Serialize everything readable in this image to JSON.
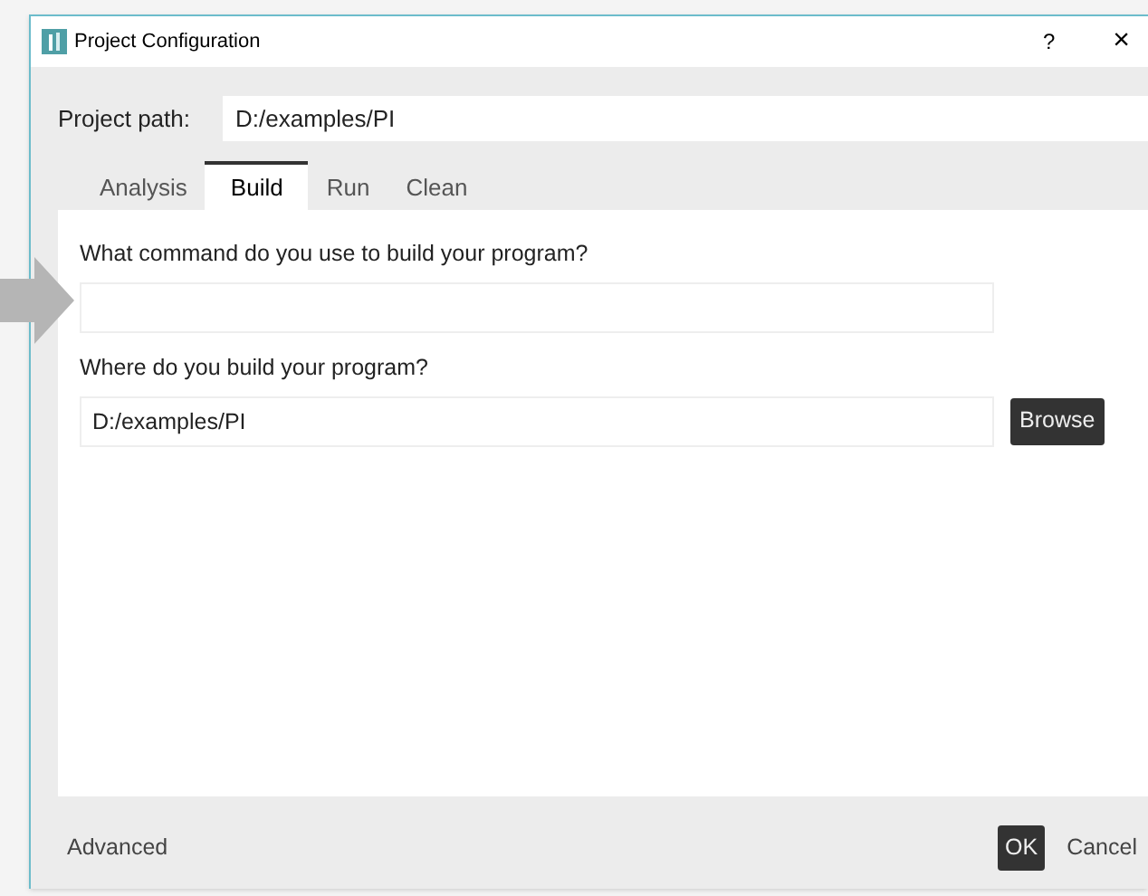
{
  "window": {
    "title": "Project Configuration",
    "help": "?",
    "close": "×"
  },
  "project_path": {
    "label": "Project path:",
    "value": "D:/examples/PI"
  },
  "tabs": [
    {
      "label": "Analysis",
      "selected": false
    },
    {
      "label": "Build",
      "selected": true
    },
    {
      "label": "Run",
      "selected": false
    },
    {
      "label": "Clean",
      "selected": false
    }
  ],
  "build": {
    "command_label": "What command do you use to build your program?",
    "dir_label": "Where do you build your program?",
    "dir_value": "D:/examples/PI",
    "browse": "Browse"
  },
  "footer": {
    "advanced": "Advanced",
    "ok": "OK",
    "cancel": "Cancel"
  }
}
